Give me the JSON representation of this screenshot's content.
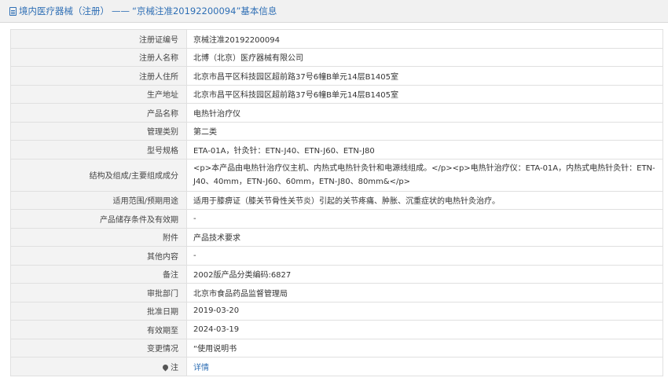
{
  "header": {
    "icon": "document-icon",
    "category": "境内医疗器械（注册）",
    "separator": "——",
    "record_title": "“京械注准20192200094”基本信息"
  },
  "rows": [
    {
      "label": "注册证编号",
      "value": "京械注准20192200094"
    },
    {
      "label": "注册人名称",
      "value": "北博（北京）医疗器械有限公司"
    },
    {
      "label": "注册人住所",
      "value": "北京市昌平区科技园区超前路37号6幢B单元14层B1405室"
    },
    {
      "label": "生产地址",
      "value": "北京市昌平区科技园区超前路37号6幢B单元14层B1405室"
    },
    {
      "label": "产品名称",
      "value": "电热针治疗仪"
    },
    {
      "label": "管理类别",
      "value": "第二类"
    },
    {
      "label": "型号规格",
      "value": "ETA-01A，针灸针：ETN-J40、ETN-J60、ETN-J80"
    },
    {
      "label": "结构及组成/主要组成成分",
      "value": "<p>本产品由电热针治疗仪主机、内热式电热针灸针和电源线组成。</p><p>电热针治疗仪：ETA-01A，内热式电热针灸针：ETN-J40、40mm，ETN-J60、60mm，ETN-J80、80mm&</p>"
    },
    {
      "label": "适用范围/预期用途",
      "value": "适用于膝痹证（膝关节骨性关节炎）引起的关节疼痛、肿胀、沉重症状的电热针灸治疗。"
    },
    {
      "label": "产品储存条件及有效期",
      "value": "-"
    },
    {
      "label": "附件",
      "value": "产品技术要求"
    },
    {
      "label": "其他内容",
      "value": "-"
    },
    {
      "label": "备注",
      "value": "2002版产品分类编码:6827"
    },
    {
      "label": "审批部门",
      "value": "北京市食品药品监督管理局"
    },
    {
      "label": "批准日期",
      "value": "2019-03-20"
    },
    {
      "label": "有效期至",
      "value": "2024-03-19"
    },
    {
      "label": "变更情况",
      "value": "“使用说明书"
    }
  ],
  "note_row": {
    "icon": "map-pin-icon",
    "label": "注",
    "link": "详情"
  }
}
